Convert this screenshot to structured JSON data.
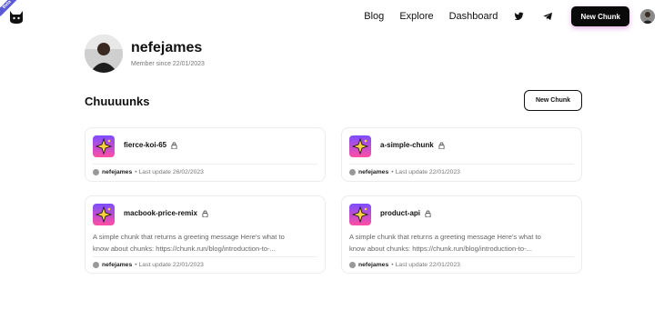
{
  "header": {
    "beta_label": "Beta",
    "nav": {
      "blog": "Blog",
      "explore": "Explore",
      "dashboard": "Dashboard",
      "cta": "New Chunk"
    },
    "icons": [
      "cat-logo-icon",
      "twitter-icon",
      "telegram-icon",
      "user-avatar"
    ],
    "accent_shadow": "#c850c8"
  },
  "profile": {
    "username": "nefejames",
    "member_since": "Member since 22/01/2023"
  },
  "section": {
    "title": "Chuuuunks",
    "new_button": "New Chunk"
  },
  "chunks": [
    {
      "title": "fierce-koi-65",
      "description": "",
      "author": "nefejames",
      "updated": "• Last update 26/02/2023"
    },
    {
      "title": "a-simple-chunk",
      "description": "",
      "author": "nefejames",
      "updated": "• Last update 22/01/2023"
    },
    {
      "title": "macbook-price-remix",
      "description_line1": "A simple chunk that returns a greeting message Here's what to",
      "description_line2": "know about chunks: https://chunk.run/blog/introduction-to-...",
      "author": "nefejames",
      "updated": "• Last update 22/01/2023"
    },
    {
      "title": "product-api",
      "description_line1": "A simple chunk that returns a greeting message Here's what to",
      "description_line2": "know about chunks: https://chunk.run/blog/introduction-to-...",
      "author": "nefejames",
      "updated": "• Last update 22/01/2023"
    }
  ],
  "colors": {
    "chunk_icon_top": "#7c4dff",
    "chunk_icon_bottom": "#ff4fa3",
    "sparkle": "#ffd23f"
  }
}
